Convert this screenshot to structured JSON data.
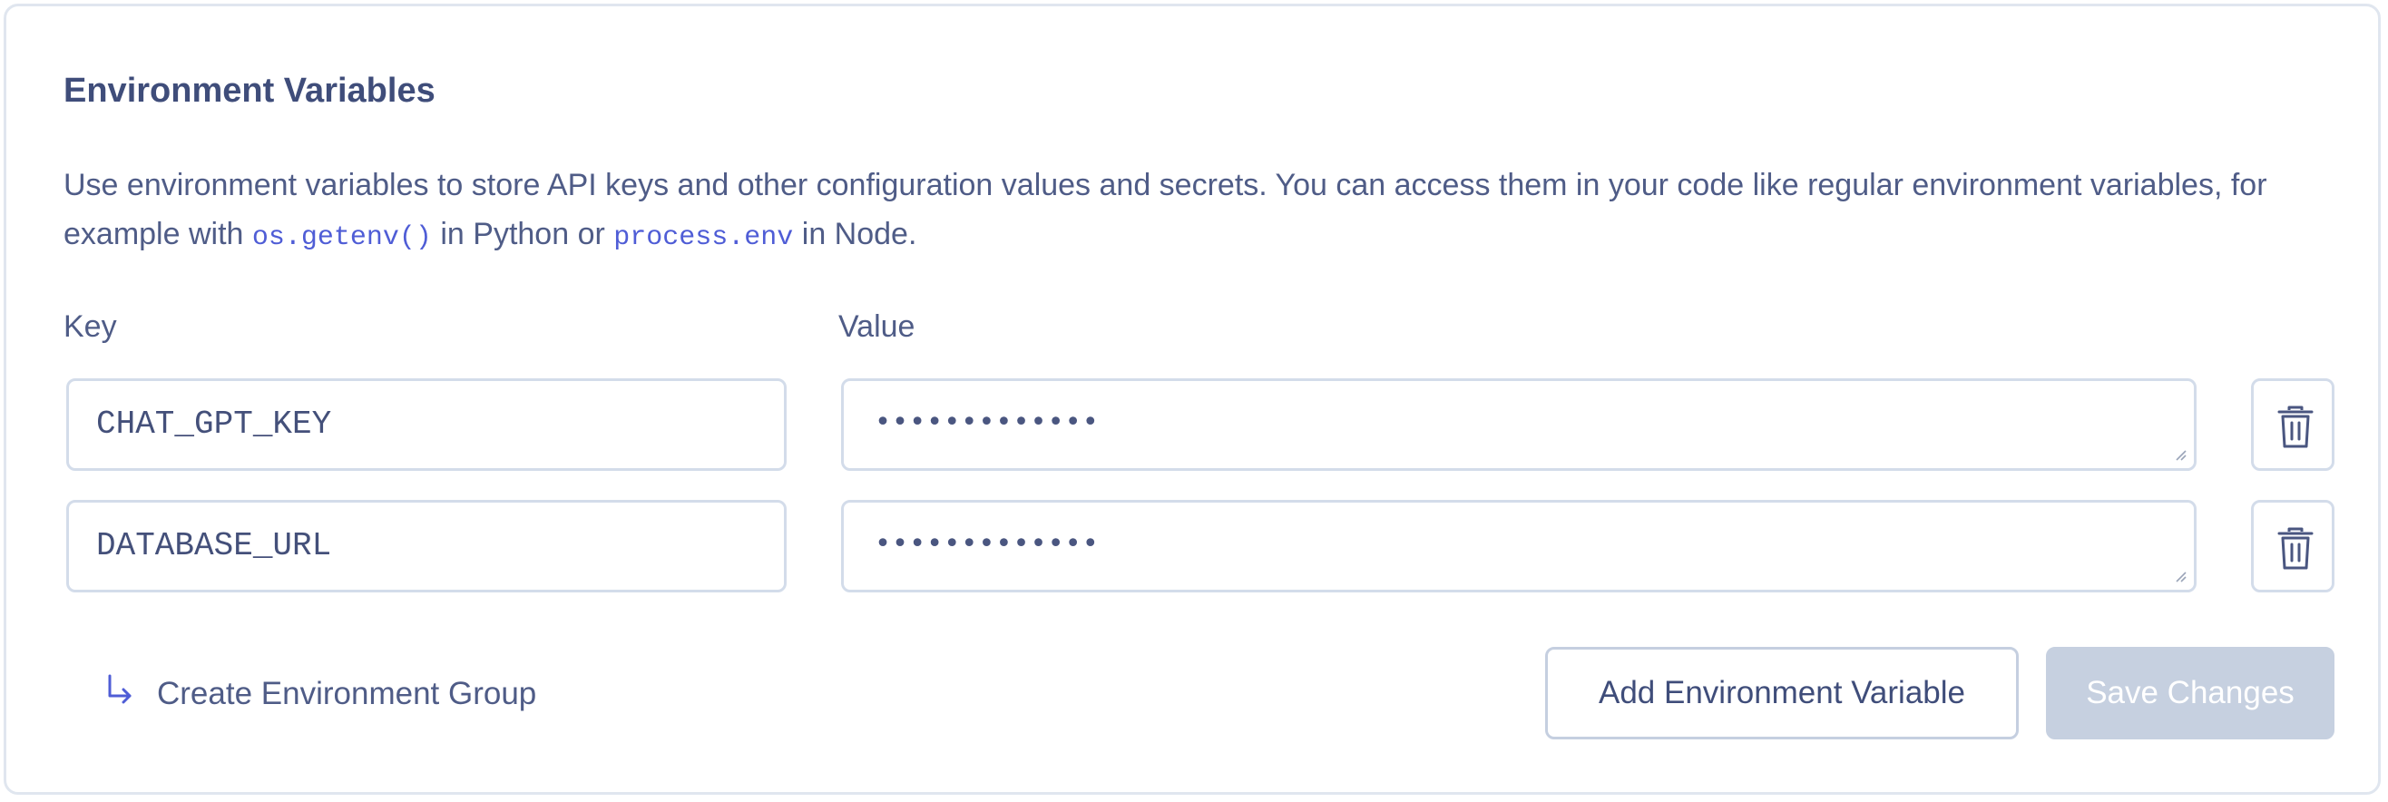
{
  "section": {
    "title": "Environment Variables",
    "description_part1": "Use environment variables to store API keys and other configuration values and secrets. You can access them in your code like regular environment variables, for example with ",
    "code1": "os.getenv()",
    "description_part2": " in Python or ",
    "code2": "process.env",
    "description_part3": " in Node."
  },
  "columns": {
    "key_label": "Key",
    "value_label": "Value"
  },
  "rows": [
    {
      "key": "CHAT_GPT_KEY",
      "value": "•••••••••••••"
    },
    {
      "key": "DATABASE_URL",
      "value": "•••••••••••••"
    }
  ],
  "actions": {
    "create_group_label": "Create Environment Group",
    "add_label": "Add Environment Variable",
    "save_label": "Save Changes",
    "save_disabled": true
  },
  "icons": {
    "delete": "trash-icon",
    "create_group": "arrow-turn-down-right-icon",
    "resize": "resize-handle-icon"
  },
  "colors": {
    "text": "#414f7a",
    "code": "#4f5dd6",
    "border": "#d3dcea",
    "save_disabled_bg": "#c6d0e0"
  }
}
